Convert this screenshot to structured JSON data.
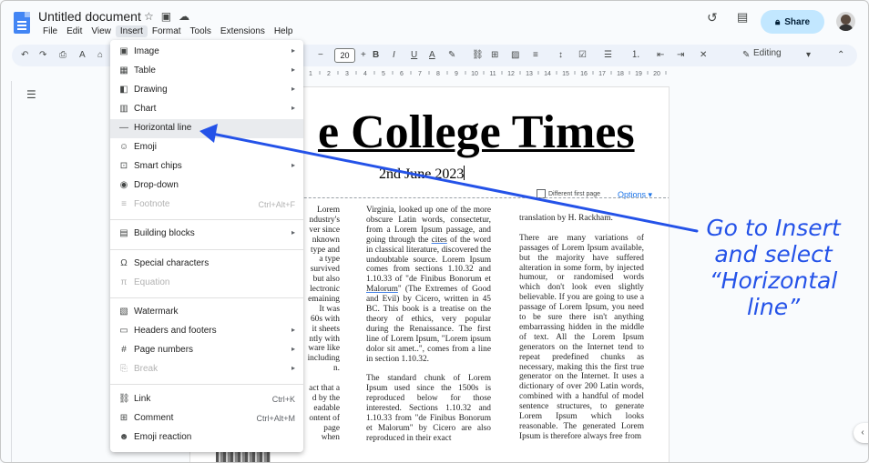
{
  "header": {
    "doc_title": "Untitled document",
    "menus": [
      "File",
      "Edit",
      "View",
      "Insert",
      "Format",
      "Tools",
      "Extensions",
      "Help"
    ],
    "active_menu": "Insert",
    "share_label": "Share"
  },
  "toolbar": {
    "font_size": "20",
    "mode_label": "Editing"
  },
  "ruler": {
    "ticks": [
      "1",
      "2",
      "3",
      "4",
      "5",
      "6",
      "7",
      "8",
      "9",
      "10",
      "11",
      "12",
      "13",
      "14",
      "15",
      "16",
      "17",
      "18",
      "19",
      "20"
    ]
  },
  "insert_menu": {
    "items": [
      {
        "label": "Image",
        "icon": "image-icon",
        "submenu": true,
        "shortcut": ""
      },
      {
        "label": "Table",
        "icon": "table-icon",
        "submenu": true,
        "shortcut": ""
      },
      {
        "label": "Drawing",
        "icon": "drawing-icon",
        "submenu": true,
        "shortcut": ""
      },
      {
        "label": "Chart",
        "icon": "chart-icon",
        "submenu": true,
        "shortcut": ""
      },
      {
        "label": "Horizontal line",
        "icon": "horizontal-line-icon",
        "submenu": false,
        "shortcut": ""
      },
      {
        "label": "Emoji",
        "icon": "emoji-icon",
        "submenu": false,
        "shortcut": ""
      },
      {
        "label": "Smart chips",
        "icon": "smart-chips-icon",
        "submenu": true,
        "shortcut": ""
      },
      {
        "label": "Drop-down",
        "icon": "dropdown-icon",
        "submenu": false,
        "shortcut": ""
      },
      {
        "label": "Footnote",
        "icon": "footnote-icon",
        "submenu": false,
        "shortcut": "Ctrl+Alt+F"
      },
      {
        "label": "Building blocks",
        "icon": "building-blocks-icon",
        "submenu": true,
        "shortcut": ""
      },
      {
        "label": "Special characters",
        "icon": "omega-icon",
        "submenu": false,
        "shortcut": ""
      },
      {
        "label": "Equation",
        "icon": "pi-icon",
        "submenu": false,
        "shortcut": ""
      },
      {
        "label": "Watermark",
        "icon": "watermark-icon",
        "submenu": false,
        "shortcut": ""
      },
      {
        "label": "Headers and footers",
        "icon": "headers-icon",
        "submenu": true,
        "shortcut": ""
      },
      {
        "label": "Page numbers",
        "icon": "hash-icon",
        "submenu": true,
        "shortcut": ""
      },
      {
        "label": "Break",
        "icon": "break-icon",
        "submenu": true,
        "shortcut": ""
      },
      {
        "label": "Link",
        "icon": "link-icon",
        "submenu": false,
        "shortcut": "Ctrl+K"
      },
      {
        "label": "Comment",
        "icon": "comment-icon",
        "submenu": false,
        "shortcut": "Ctrl+Alt+M"
      },
      {
        "label": "Emoji reaction",
        "icon": "emoji-reaction-icon",
        "submenu": false,
        "shortcut": ""
      }
    ]
  },
  "document": {
    "heading": "e College Times",
    "date": "2nd June 2023",
    "header_option_checkbox": "Different first page",
    "header_options_link": "Options",
    "col1": [
      "Lorem",
      "ndustry's",
      "ver since",
      "nknown",
      "type and",
      "a type",
      "survived",
      "but also",
      "lectronic",
      "emaining",
      "It was",
      "60s with",
      "it sheets",
      "ntly with",
      "ware like",
      "including",
      "n.",
      "",
      "act that a",
      "d by the",
      "eadable",
      "ontent of",
      "page",
      "when"
    ],
    "col2_p1": "Virginia, looked up one of the more obscure Latin words, consectetur, from a Lorem Ipsum passage, and going through the ",
    "col2_cites": "cites",
    "col2_p1b": " of the word in classical literature, discovered the undoubtable source. Lorem Ipsum comes from sections 1.10.32 and 1.10.33 of \"de Finibus Bonorum et ",
    "col2_malorum": "Malorum",
    "col2_p1c": "\" (The Extremes of Good and Evil) by Cicero, written in 45 BC. This book is a treatise on the theory of ethics, very popular during the Renaissance. The first line of Lorem Ipsum, \"Lorem ipsum dolor sit amet..\", comes from a line in section 1.10.32.",
    "col2_p2": "The standard chunk of Lorem Ipsum used since the 1500s is reproduced below for those interested. Sections 1.10.32 and 1.10.33 from \"de Finibus Bonorum et Malorum\" by Cicero are also reproduced in their exact",
    "col3_p1": "translation by H. Rackham.",
    "col3_p2": "There are many variations of passages of Lorem Ipsum available, but the majority have suffered alteration in some form, by injected humour, or randomised words which don't look even slightly believable. If you are going to use a passage of Lorem Ipsum, you need to be sure there isn't anything embarrassing hidden in the middle of text. All the Lorem Ipsum generators on the Internet tend to repeat predefined chunks as necessary, making this the first true generator on the Internet. It uses a dictionary of over 200 Latin words, combined with a handful of model sentence structures, to generate Lorem Ipsum which looks reasonable. The generated Lorem Ipsum is therefore always free from"
  },
  "annotation": {
    "lines": [
      "Go to Insert",
      "and select",
      "“Horizontal",
      "line”"
    ],
    "color": "#2452e8"
  },
  "colors": {
    "share_bg": "#c2e7ff",
    "toolbar_bg": "#edf2fa",
    "menu_highlight": "#e9ebee",
    "link_blue": "#1a73e8"
  }
}
